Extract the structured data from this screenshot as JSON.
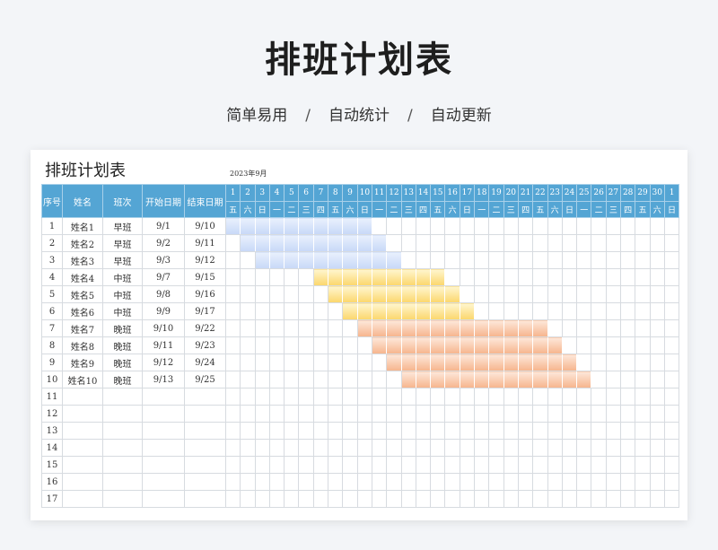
{
  "hero": {
    "title": "排班计划表",
    "subtitle": [
      "简单易用",
      "自动统计",
      "自动更新"
    ],
    "separator": "/"
  },
  "sheet": {
    "title": "排班计划表",
    "month_label": "2023年9月",
    "columns": [
      "序号",
      "姓名",
      "班次",
      "开始日期",
      "结束日期"
    ],
    "days": [
      "1",
      "2",
      "3",
      "4",
      "5",
      "6",
      "7",
      "8",
      "9",
      "10",
      "11",
      "12",
      "13",
      "14",
      "15",
      "16",
      "17",
      "18",
      "19",
      "20",
      "21",
      "22",
      "23",
      "24",
      "25",
      "26",
      "27",
      "28",
      "29",
      "30",
      "1"
    ],
    "weekdays": [
      "五",
      "六",
      "日",
      "一",
      "二",
      "三",
      "四",
      "五",
      "六",
      "日",
      "一",
      "二",
      "三",
      "四",
      "五",
      "六",
      "日",
      "一",
      "二",
      "三",
      "四",
      "五",
      "六",
      "日",
      "一",
      "二",
      "三",
      "四",
      "五",
      "六",
      "日"
    ],
    "rows": [
      {
        "no": "1",
        "name": "姓名1",
        "shift": "早班",
        "start": "9/1",
        "end": "9/10",
        "bar_start": 1,
        "bar_end": 10
      },
      {
        "no": "2",
        "name": "姓名2",
        "shift": "早班",
        "start": "9/2",
        "end": "9/11",
        "bar_start": 2,
        "bar_end": 11
      },
      {
        "no": "3",
        "name": "姓名3",
        "shift": "早班",
        "start": "9/3",
        "end": "9/12",
        "bar_start": 3,
        "bar_end": 12
      },
      {
        "no": "4",
        "name": "姓名4",
        "shift": "中班",
        "start": "9/7",
        "end": "9/15",
        "bar_start": 7,
        "bar_end": 15
      },
      {
        "no": "5",
        "name": "姓名5",
        "shift": "中班",
        "start": "9/8",
        "end": "9/16",
        "bar_start": 8,
        "bar_end": 16
      },
      {
        "no": "6",
        "name": "姓名6",
        "shift": "中班",
        "start": "9/9",
        "end": "9/17",
        "bar_start": 9,
        "bar_end": 17
      },
      {
        "no": "7",
        "name": "姓名7",
        "shift": "晚班",
        "start": "9/10",
        "end": "9/22",
        "bar_start": 10,
        "bar_end": 22
      },
      {
        "no": "8",
        "name": "姓名8",
        "shift": "晚班",
        "start": "9/11",
        "end": "9/23",
        "bar_start": 11,
        "bar_end": 23
      },
      {
        "no": "9",
        "name": "姓名9",
        "shift": "晚班",
        "start": "9/12",
        "end": "9/24",
        "bar_start": 12,
        "bar_end": 24
      },
      {
        "no": "10",
        "name": "姓名10",
        "shift": "晚班",
        "start": "9/13",
        "end": "9/25",
        "bar_start": 13,
        "bar_end": 25
      },
      {
        "no": "11",
        "name": "",
        "shift": "",
        "start": "",
        "end": ""
      },
      {
        "no": "12",
        "name": "",
        "shift": "",
        "start": "",
        "end": ""
      },
      {
        "no": "13",
        "name": "",
        "shift": "",
        "start": "",
        "end": ""
      },
      {
        "no": "14",
        "name": "",
        "shift": "",
        "start": "",
        "end": ""
      },
      {
        "no": "15",
        "name": "",
        "shift": "",
        "start": "",
        "end": ""
      },
      {
        "no": "16",
        "name": "",
        "shift": "",
        "start": "",
        "end": ""
      },
      {
        "no": "17",
        "name": "",
        "shift": "",
        "start": "",
        "end": ""
      }
    ],
    "shift_colors": {
      "早班": [
        "#e9f0fd",
        "#c7d8f7"
      ],
      "中班": [
        "#fff6cf",
        "#fbd66b"
      ],
      "晚班": [
        "#fde8da",
        "#f6b48c"
      ]
    }
  }
}
